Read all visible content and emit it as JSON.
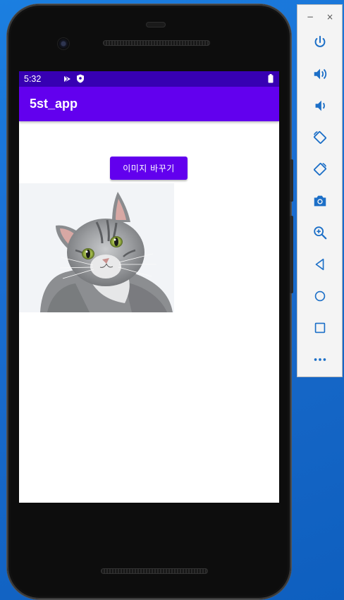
{
  "status_bar": {
    "time": "5:32"
  },
  "app_bar": {
    "title": "5st_app"
  },
  "main": {
    "change_image_button": "이미지 바꾸기"
  },
  "emulator_panel": {
    "window_controls": {
      "minimize": "−",
      "close": "×"
    },
    "buttons": [
      "power-icon",
      "volume-up-icon",
      "volume-down-icon",
      "rotate-left-icon",
      "rotate-right-icon",
      "screenshot-icon",
      "zoom-icon",
      "back-icon",
      "home-icon",
      "overview-icon",
      "more-icon"
    ]
  },
  "colors": {
    "status_bar": "#3700b3",
    "primary": "#6200ee",
    "desktop": "#1a6fd4"
  }
}
